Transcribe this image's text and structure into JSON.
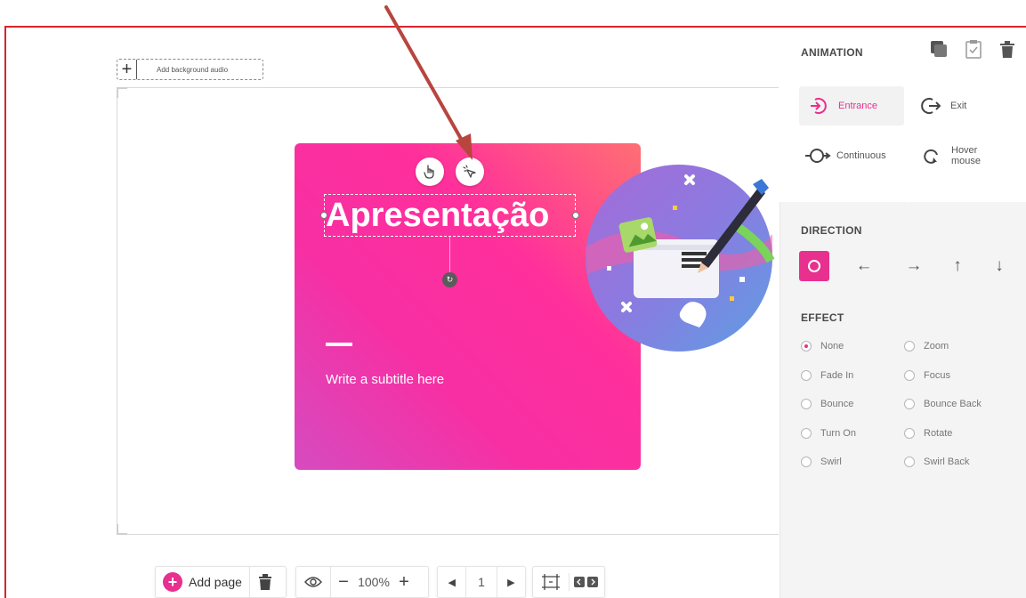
{
  "canvas": {
    "audio_label": "Add background audio",
    "title": "Apresentação",
    "subtitle": "Write a subtitle here"
  },
  "panel": {
    "animation_header": "ANIMATION",
    "anim_types": [
      {
        "label": "Entrance",
        "active": true
      },
      {
        "label": "Exit",
        "active": false
      },
      {
        "label": "Continuous",
        "active": false
      },
      {
        "label": "Hover mouse",
        "active": false
      }
    ],
    "direction_header": "DIRECTION",
    "directions": [
      "O",
      "←",
      "→",
      "↑",
      "↓"
    ],
    "effect_header": "EFFECT",
    "effects_left": [
      "None",
      "Fade In",
      "Bounce",
      "Turn On",
      "Swirl"
    ],
    "effects_right": [
      "Zoom",
      "Focus",
      "Bounce Back",
      "Rotate",
      "Swirl Back"
    ],
    "selected_effect": "None"
  },
  "bottom_toolbar": {
    "add_page_label": "Add page",
    "zoom": "100%",
    "page_number": "1"
  },
  "colors": {
    "accent": "#e8308f",
    "frame_border": "#d9232e",
    "annotation_arrow": "#b8453e"
  }
}
